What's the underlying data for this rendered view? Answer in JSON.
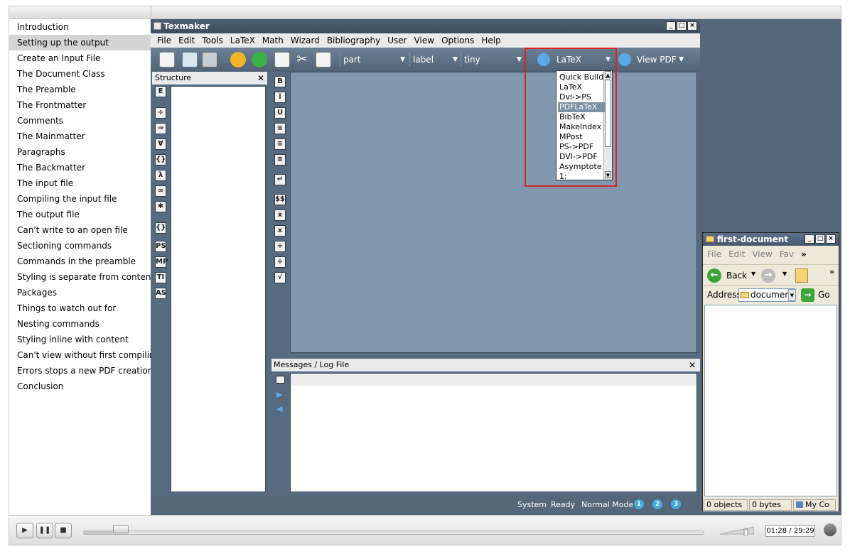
{
  "chapters": {
    "active_index": 1,
    "items": [
      "Introduction",
      "Setting up the output",
      "Create an Input File",
      "The Document Class",
      "The Preamble",
      "The Frontmatter",
      "Comments",
      "The Mainmatter",
      "Paragraphs",
      "The Backmatter",
      "The input file",
      "Compiling the input file",
      "The output file",
      "Can't write to an open file",
      "Sectioning commands",
      "Commands in the preamble",
      "Styling is separate from content",
      "Packages",
      "Things to watch out for",
      "Nesting commands",
      "Styling inline with content",
      "Can't view without first compiling",
      "Errors stops a new PDF creation!",
      "Conclusion"
    ]
  },
  "texmaker": {
    "title": "Texmaker",
    "menu": [
      "File",
      "Edit",
      "Tools",
      "LaTeX",
      "Math",
      "Wizard",
      "Bibliography",
      "User",
      "View",
      "Options",
      "Help"
    ],
    "toolbar": {
      "combo_part": "part",
      "combo_label": "label",
      "combo_size": "tiny",
      "combo_build": "LaTeX",
      "combo_view": "View PDF"
    },
    "structure_title": "Structure",
    "structure_icons": [
      "E",
      "÷",
      "⇒",
      "∀",
      "{}",
      "λ",
      "∞",
      "✱",
      "{}",
      "PS",
      "MP",
      "TI",
      "AS"
    ],
    "vertical_icons": [
      "B",
      "i",
      "U",
      "≡",
      "≡",
      "≡",
      "↵",
      "$$",
      "x",
      "x",
      "÷",
      "÷",
      "√"
    ],
    "build_dropdown": {
      "hover_index": 3,
      "items": [
        "Quick Build",
        "LaTeX",
        "Dvi->PS",
        "PDFLaTeX",
        "BibTeX",
        "MakeIndex",
        "MPost",
        "PS->PDF",
        "DVI->PDF",
        "Asymptote",
        "1:"
      ]
    },
    "messages_title": "Messages / Log File",
    "status": {
      "system": "System",
      "ready": "Ready",
      "mode": "Normal Mode",
      "badges": [
        "1",
        "2",
        "3"
      ]
    }
  },
  "explorer": {
    "title": "first-document",
    "menu": [
      "File",
      "Edit",
      "View",
      "Fav"
    ],
    "back_label": "Back",
    "address_label": "Address",
    "address_value": "document",
    "go_label": "Go",
    "status_objects": "0 objects",
    "status_bytes": "0 bytes",
    "status_location": "My Co"
  },
  "player": {
    "progress": 0.048,
    "volume": 0.8,
    "time": "01:28 / 29:29"
  }
}
